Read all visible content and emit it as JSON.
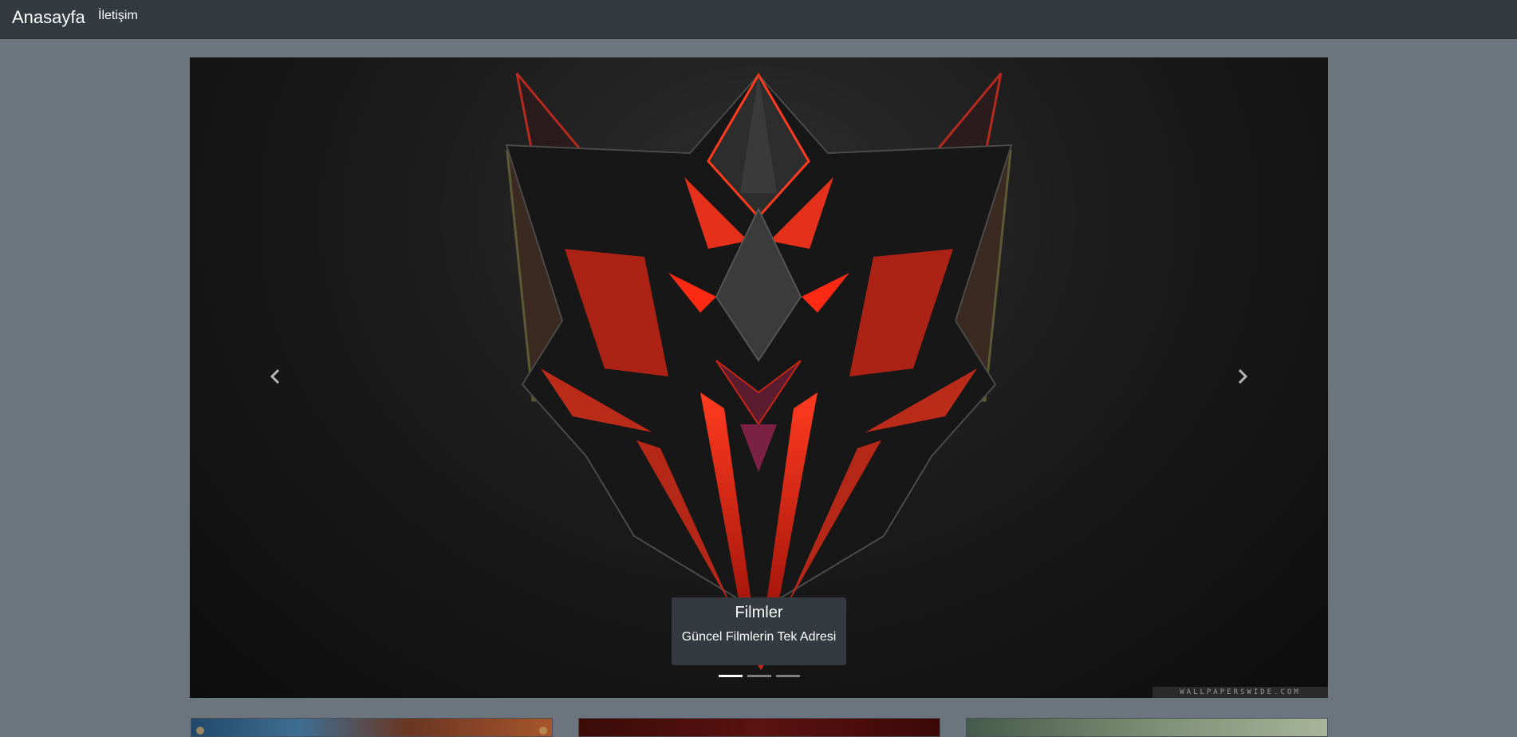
{
  "navbar": {
    "brand": "Anasayfa",
    "links": [
      {
        "label": "İletişim"
      }
    ]
  },
  "carousel": {
    "caption_title": "Filmler",
    "caption_text": "Güncel Filmlerin Tek Adresi",
    "slide_count": 3,
    "active_slide": 1,
    "prev_icon": "chevron-left-icon",
    "next_icon": "chevron-right-icon",
    "watermark": "WALLPAPERSWIDE.COM"
  },
  "cards": [
    {
      "name": "movie-card-1"
    },
    {
      "name": "movie-card-2"
    },
    {
      "name": "movie-card-3"
    }
  ],
  "colors": {
    "navbar_bg": "#343a40",
    "page_bg": "#6c757d",
    "caption_bg": "#343a40",
    "accent_red": "#e52a14"
  }
}
